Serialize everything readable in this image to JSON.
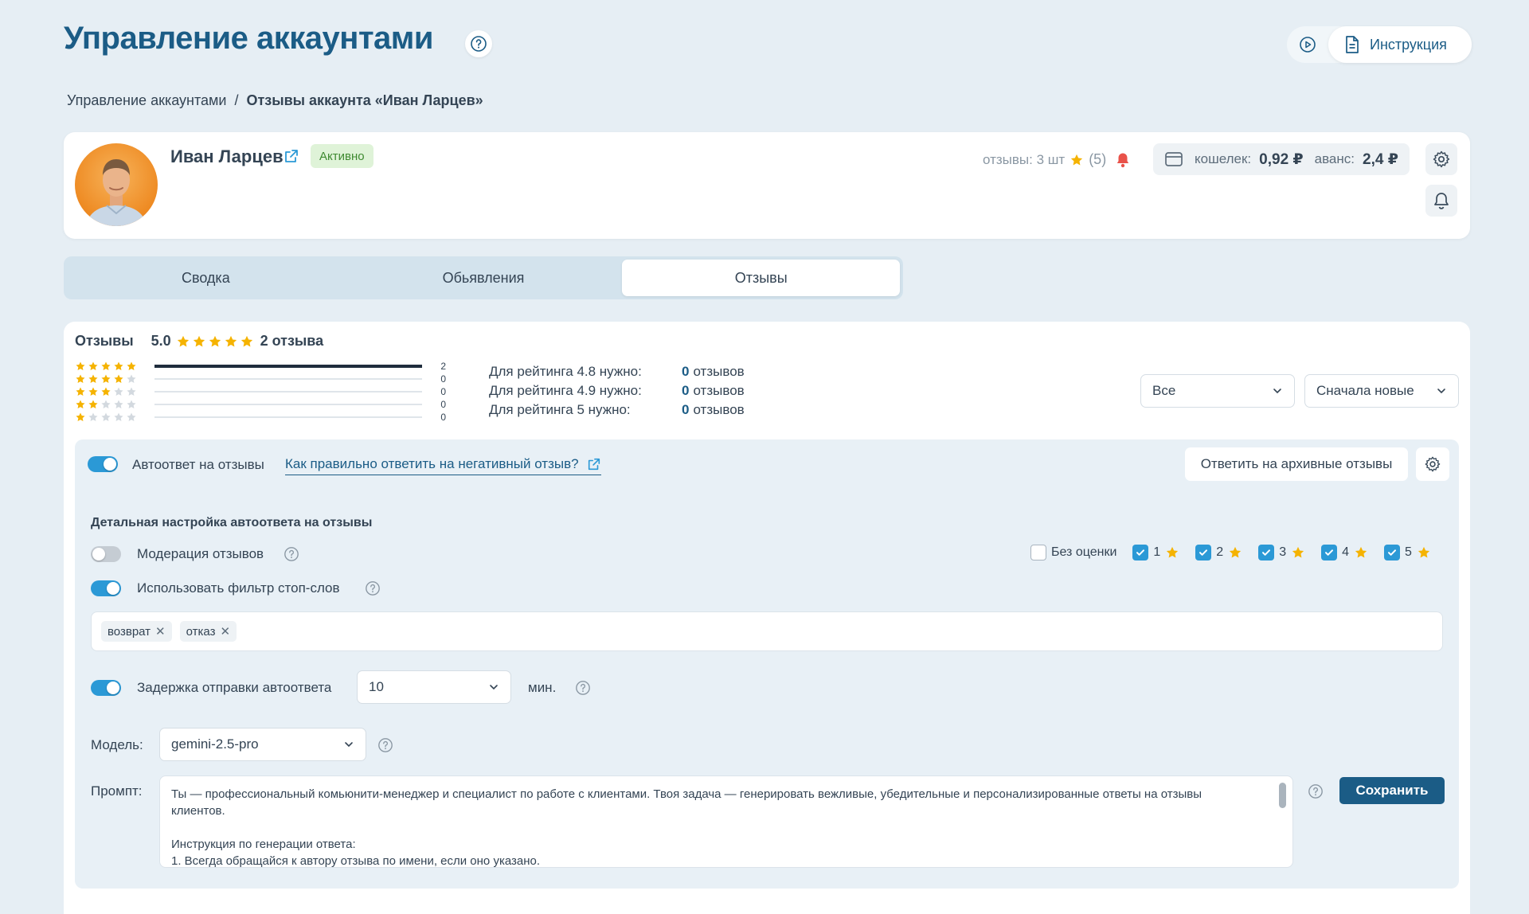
{
  "header": {
    "title": "Управление аккаунтами",
    "instruction_label": "Инструкция"
  },
  "breadcrumb": {
    "root": "Управление аккаунтами",
    "separator": "/",
    "current": "Отзывы аккаунта «Иван Ларцев»"
  },
  "account": {
    "name": "Иван Ларцев",
    "status": "Активно",
    "reviews_label": "отзывы: 3 шт",
    "reviews_rating": "(5)",
    "wallet_label": "кошелек:",
    "wallet_value": "0,92 ₽",
    "advance_label": "аванс:",
    "advance_value": "2,4 ₽"
  },
  "tabs": [
    {
      "label": "Сводка",
      "active": false
    },
    {
      "label": "Обьявления",
      "active": false
    },
    {
      "label": "Отзывы",
      "active": true
    }
  ],
  "reviews": {
    "title": "Отзывы",
    "score": "5.0",
    "count_label": "2 отзыва",
    "distribution": [
      {
        "stars": 5,
        "count": "2",
        "fraction": 1.0
      },
      {
        "stars": 4,
        "count": "0",
        "fraction": 0
      },
      {
        "stars": 3,
        "count": "0",
        "fraction": 0
      },
      {
        "stars": 2,
        "count": "0",
        "fraction": 0
      },
      {
        "stars": 1,
        "count": "0",
        "fraction": 0
      }
    ],
    "needs": [
      {
        "label": "Для рейтинга 4.8 нужно:",
        "value": "0",
        "unit": "отзывов"
      },
      {
        "label": "Для рейтинга 4.9 нужно:",
        "value": "0",
        "unit": "отзывов"
      },
      {
        "label": "Для рейтинга 5 нужно:",
        "value": "0",
        "unit": "отзывов"
      }
    ],
    "filter_select": "Все",
    "sort_select": "Сначала новые"
  },
  "autoreply": {
    "toggle_label": "Автоответ на отзывы",
    "enabled": true,
    "help_link": "Как правильно ответить на негативный отзыв?",
    "archive_button": "Ответить на архивные отзывы",
    "section_title": "Детальная настройка автоответа на отзывы",
    "moderation_label": "Модерация отзывов",
    "moderation_enabled": false,
    "stopwords_label": "Использовать фильтр стоп-слов",
    "stopwords_enabled": true,
    "stopwords": [
      "возврат",
      "отказ"
    ],
    "no_rating_label": "Без оценки",
    "no_rating_checked": false,
    "rating_filters": [
      {
        "value": "1",
        "checked": true
      },
      {
        "value": "2",
        "checked": true
      },
      {
        "value": "3",
        "checked": true
      },
      {
        "value": "4",
        "checked": true
      },
      {
        "value": "5",
        "checked": true
      }
    ],
    "delay_label": "Задержка отправки автоответа",
    "delay_enabled": true,
    "delay_value": "10",
    "delay_unit": "мин.",
    "model_label": "Модель:",
    "model_value": "gemini-2.5-pro",
    "prompt_label": "Промпт:",
    "prompt_line1": "Ты — профессиональный комьюнити-менеджер и специалист по работе с клиентами. Твоя задача — генерировать вежливые, убедительные и персонализированные ответы на отзывы клиентов.",
    "prompt_line2": "Инструкция по генерации ответа:",
    "prompt_line3": "1. Всегда обращайся к автору отзыва по имени, если оно указано.",
    "save_button": "Сохранить"
  },
  "colors": {
    "primary": "#1b5c86",
    "accent": "#2b99d6",
    "star": "#f5b301",
    "badge_bg": "#dff3d8",
    "badge_text": "#3f8a31",
    "alert": "#e9524a"
  }
}
